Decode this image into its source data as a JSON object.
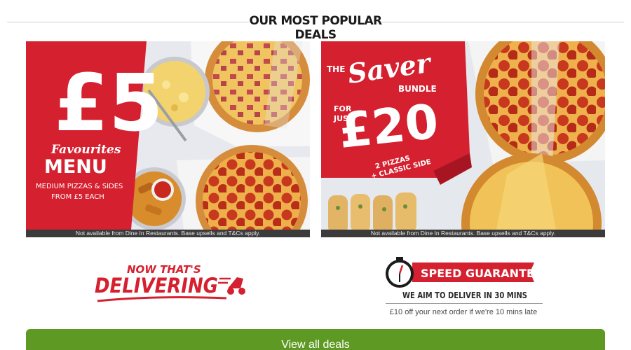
{
  "header": {
    "title": "OUR MOST POPULAR DEALS"
  },
  "deals": [
    {
      "amount": "£5",
      "line1": "Favourites",
      "line2": "MENU",
      "line3": "MEDIUM PIZZAS & SIDES",
      "line4": "FROM £5 EACH",
      "disclaimer": "Not available from Dine In Restaurants. Base upsells and T&Cs apply."
    },
    {
      "the": "THE",
      "saver": "Saver",
      "bundle": "BUNDLE",
      "forjust1": "FOR",
      "forjust2": "JUST",
      "amount": "£20",
      "pizzas": "2 PIZZAS",
      "side": "+ CLASSIC SIDE",
      "disclaimer": "Not available from Dine In Restaurants. Base upsells and T&Cs apply."
    }
  ],
  "delivering": {
    "line1": "NOW THAT'S",
    "line2": "DELIVERING"
  },
  "speed": {
    "title": "SPEED GUARANTEE",
    "aim": "WE AIM TO DELIVER IN 30 MINS",
    "sub": "£10 off your next order if we're 10 mins late"
  },
  "cta": {
    "label": "View all deals"
  },
  "colors": {
    "red": "#d5202f",
    "green": "#5e9a23",
    "dark": "#1b1b1b"
  }
}
